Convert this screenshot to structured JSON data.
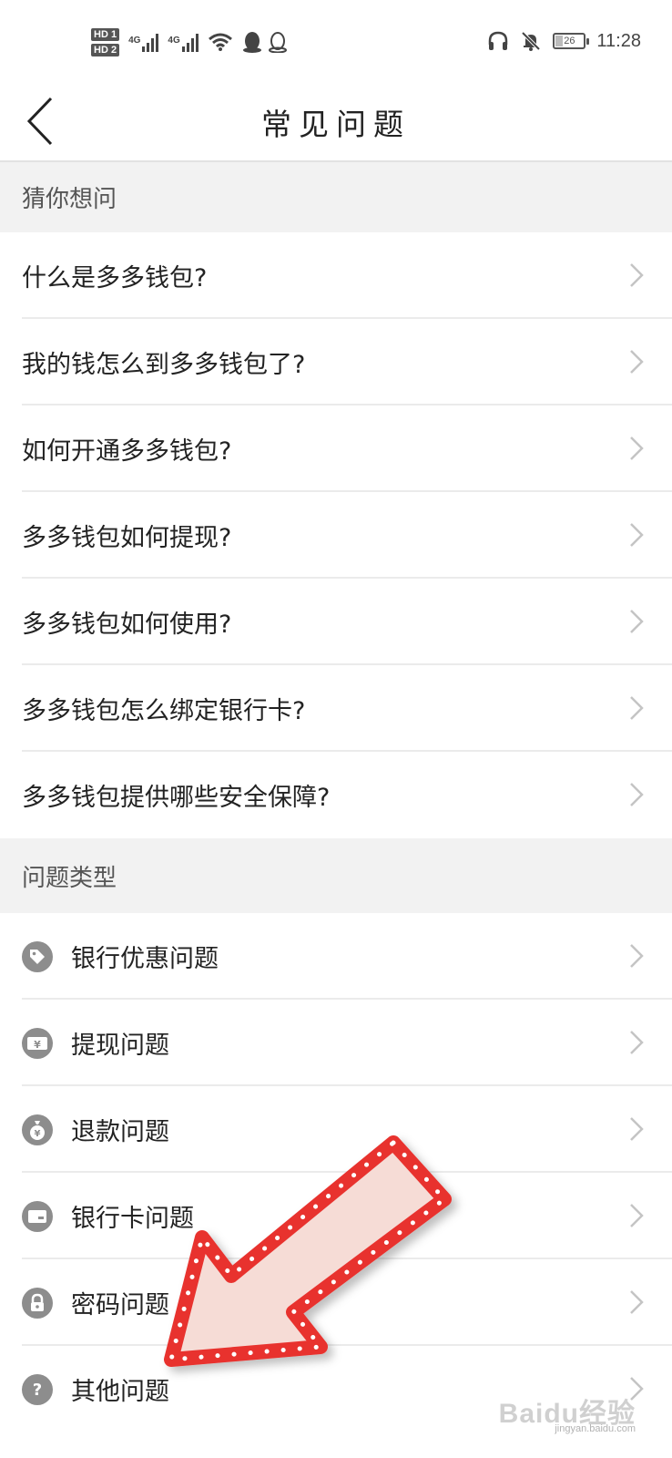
{
  "status_bar": {
    "hd1": "HD 1",
    "hd2": "HD 2",
    "net1": "4G",
    "net2": "4G",
    "battery": "26",
    "time": "11:28"
  },
  "header": {
    "back_icon": "chevron-left-icon",
    "title": "常见问题"
  },
  "guess": {
    "title": "猜你想问",
    "items": [
      {
        "label": "什么是多多钱包?"
      },
      {
        "label": "我的钱怎么到多多钱包了?"
      },
      {
        "label": "如何开通多多钱包?"
      },
      {
        "label": "多多钱包如何提现?"
      },
      {
        "label": "多多钱包如何使用?"
      },
      {
        "label": "多多钱包怎么绑定银行卡?"
      },
      {
        "label": "多多钱包提供哪些安全保障?"
      }
    ]
  },
  "types": {
    "title": "问题类型",
    "items": [
      {
        "label": "银行优惠问题",
        "icon": "tag-icon"
      },
      {
        "label": "提现问题",
        "icon": "yuan-ticket-icon"
      },
      {
        "label": "退款问题",
        "icon": "money-bag-icon"
      },
      {
        "label": "银行卡问题",
        "icon": "card-icon"
      },
      {
        "label": "密码问题",
        "icon": "lock-icon"
      },
      {
        "label": "其他问题",
        "icon": "question-icon"
      }
    ]
  },
  "watermark": {
    "brand": "Baidu经验",
    "url": "jingyan.baidu.com"
  },
  "colors": {
    "arrow_border": "#e8322e",
    "arrow_fill": "#f6dcd6",
    "icon_gray": "#8d8d8d"
  }
}
